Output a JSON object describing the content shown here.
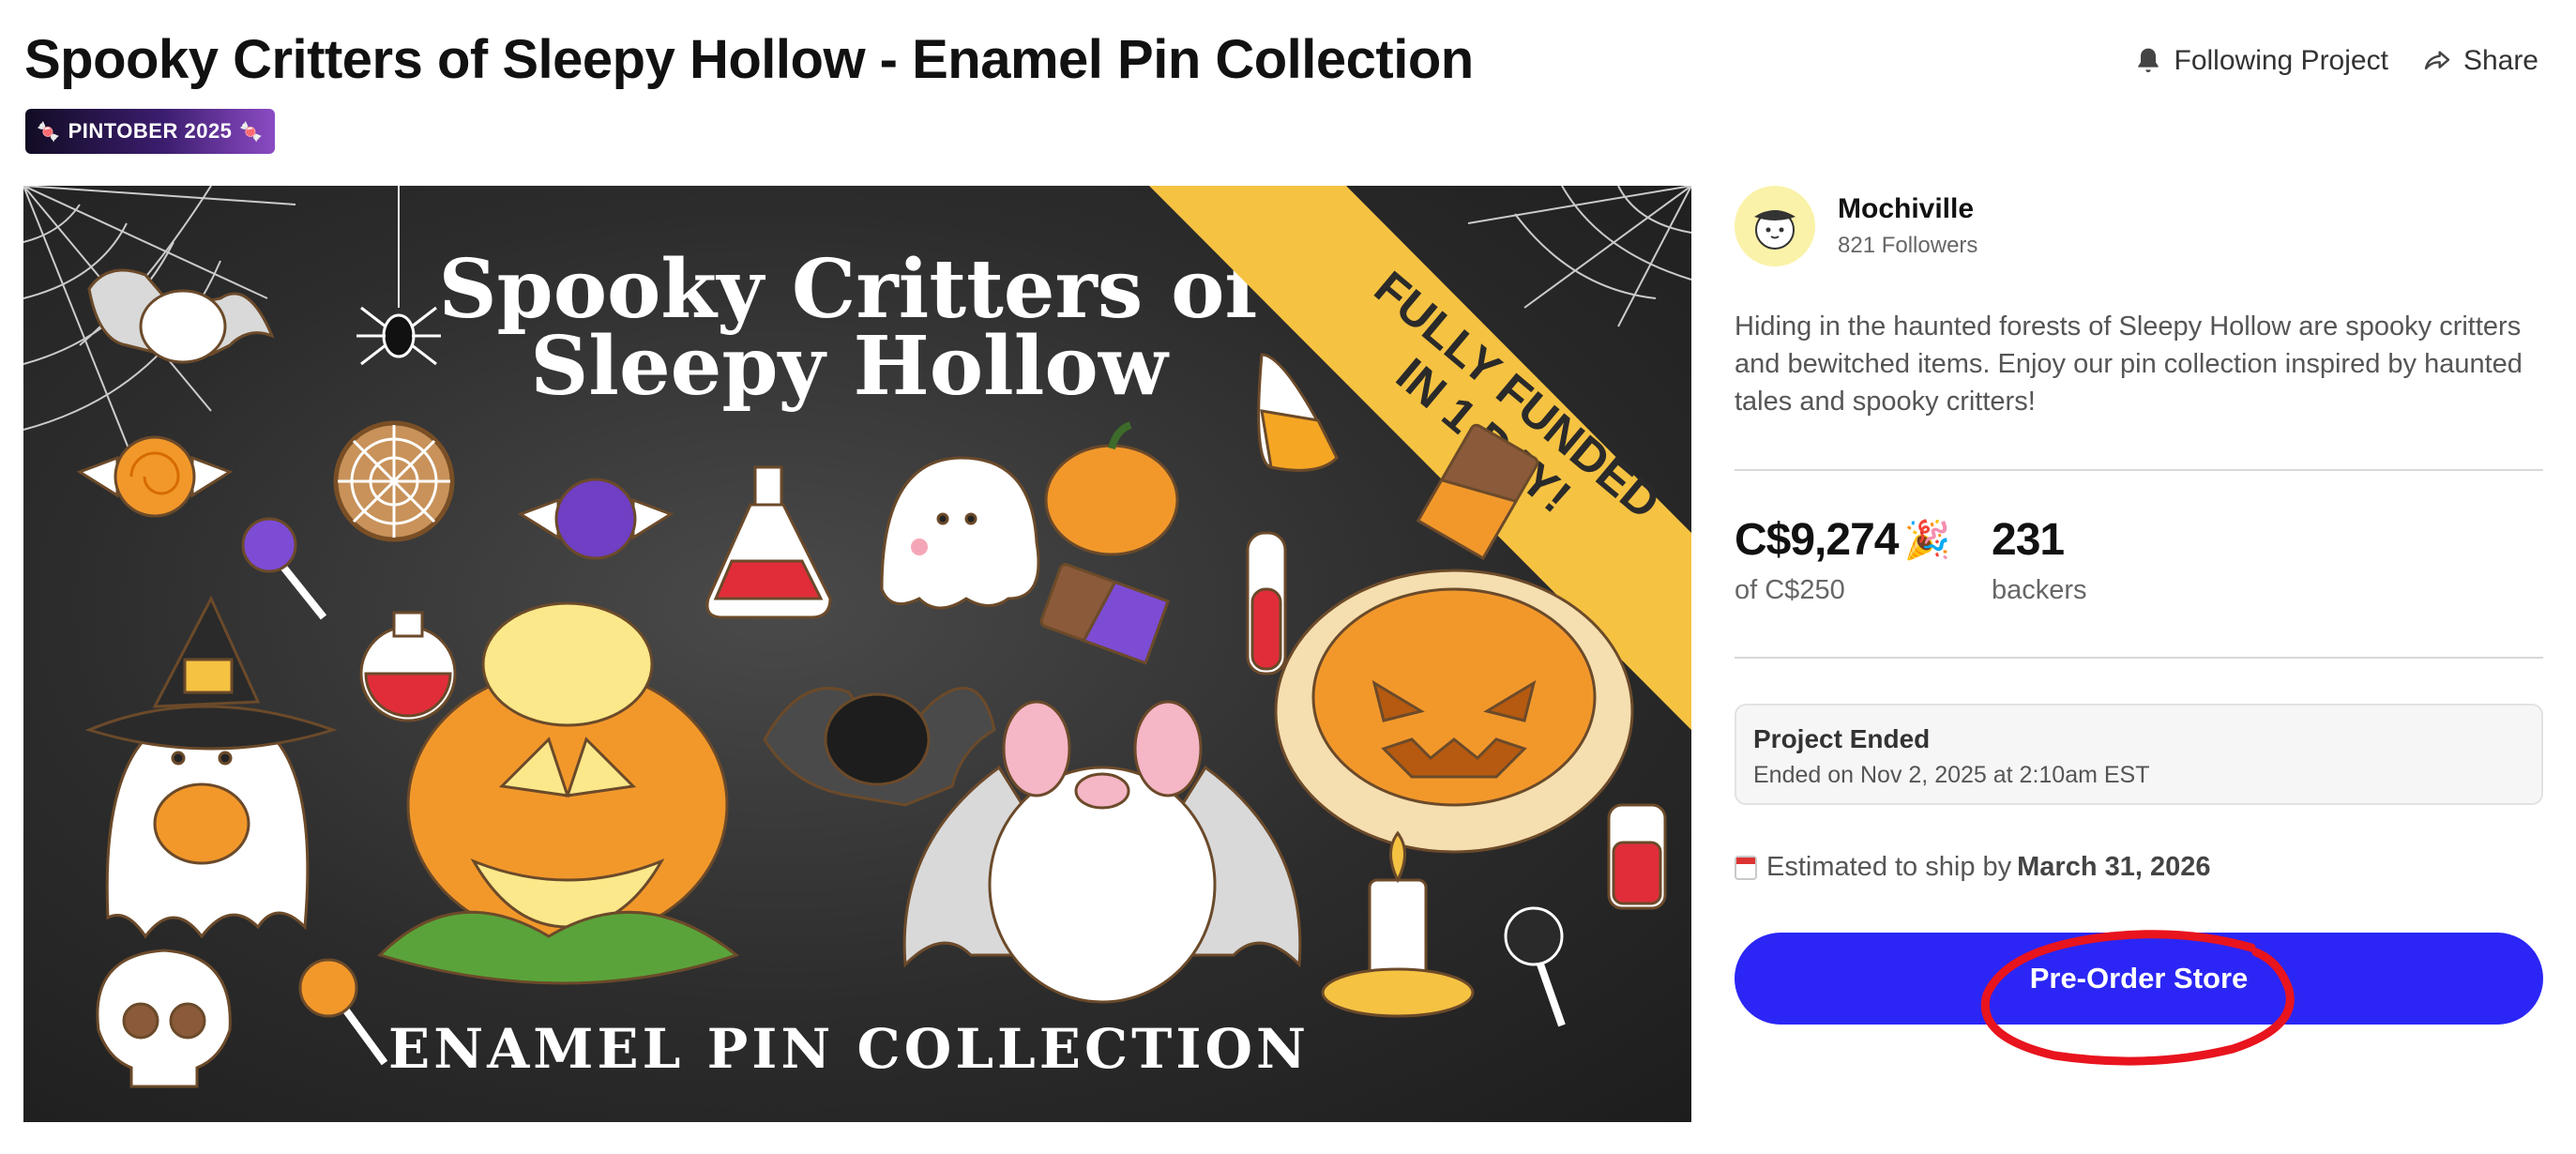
{
  "header": {
    "title": "Spooky Critters of Sleepy Hollow - Enamel Pin Collection",
    "tag": "PINTOBER 2025",
    "following_label": "Following Project",
    "share_label": "Share"
  },
  "hero": {
    "title_line1": "Spooky Critters of",
    "title_line2": "Sleepy Hollow",
    "banner_line1": "FULLY FUNDED",
    "banner_line2": "IN 1 DAY!",
    "footer": "ENAMEL PIN COLLECTION"
  },
  "creator": {
    "name": "Mochiville",
    "followers": "821 Followers"
  },
  "description": "Hiding in the haunted forests of Sleepy Hollow are spooky critters and bewitched items. Enjoy our pin collection inspired by haunted tales and spooky critters!",
  "stats": {
    "pledged": "C$9,274",
    "goal": "of C$250",
    "backers": "231",
    "backers_label": "backers"
  },
  "status": {
    "heading": "Project Ended",
    "detail": "Ended on Nov 2, 2025 at 2:10am EST"
  },
  "shipping": {
    "prefix": "Estimated to ship by",
    "date": "March 31, 2026"
  },
  "cta": {
    "label": "Pre-Order Store"
  },
  "colors": {
    "accent": "#2b26f5",
    "annotation": "#e8141e",
    "banner": "#f5c242"
  }
}
